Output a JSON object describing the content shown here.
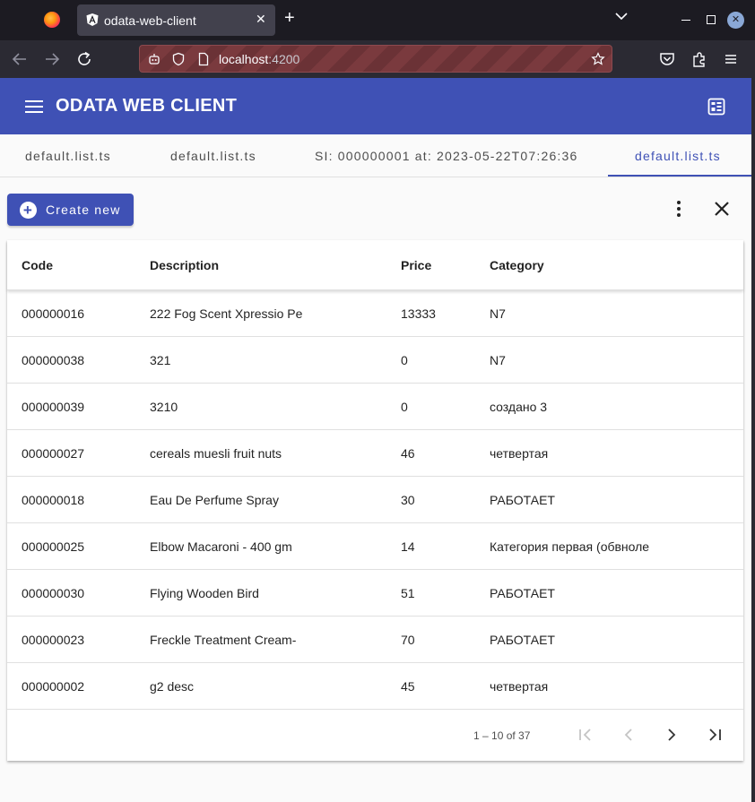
{
  "browser": {
    "tab_title": "odata-web-client",
    "url_host": "localhost",
    "url_port": ":4200"
  },
  "app": {
    "title": "ODATA WEB CLIENT",
    "tabs": [
      {
        "label": "default.list.ts",
        "active": false
      },
      {
        "label": "default.list.ts",
        "active": false
      },
      {
        "label": "SI: 000000001 at: 2023-05-22T07:26:36",
        "active": false
      },
      {
        "label": "default.list.ts",
        "active": true
      }
    ],
    "create_label": "Create new",
    "accent_color": "#3f51b5"
  },
  "table": {
    "headers": [
      "Code",
      "Description",
      "Price",
      "Category"
    ],
    "rows": [
      [
        "000000016",
        "222 Fog Scent Xpressio Pe",
        "13333",
        "N7"
      ],
      [
        "000000038",
        "321",
        "0",
        "N7"
      ],
      [
        "000000039",
        "3210",
        "0",
        "создано 3"
      ],
      [
        "000000027",
        "cereals muesli fruit nuts",
        "46",
        "четвертая"
      ],
      [
        "000000018",
        "Eau De Perfume Spray",
        "30",
        "РАБОТАЕТ"
      ],
      [
        "000000025",
        "Elbow Macaroni - 400 gm",
        "14",
        "Категория первая (обвноле"
      ],
      [
        "000000030",
        "Flying Wooden Bird",
        "51",
        "РАБОТАЕТ"
      ],
      [
        "000000023",
        "Freckle Treatment Cream-",
        "70",
        "РАБОТАЕТ"
      ],
      [
        "000000002",
        "g2 desc",
        "45",
        "четвертая"
      ]
    ]
  },
  "paginator": {
    "range_label": "1 – 10 of 37"
  }
}
